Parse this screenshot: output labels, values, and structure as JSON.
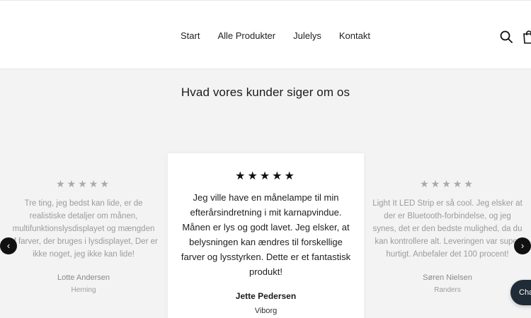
{
  "nav": {
    "items": [
      "Start",
      "Alle Produkter",
      "Julelys",
      "Kontakt"
    ]
  },
  "section": {
    "title": "Hvad vores kunder siger om os"
  },
  "reviews": [
    {
      "stars": "★★★★★",
      "text": "Tre ting, jeg bedst kan lide, er de realistiske detaljer om månen, multifunktionslysdisplayet og mængden af farver, der bruges i lysdisplayet, Der er ikke noget, jeg ikke kan lide!",
      "name": "Lotte Andersen",
      "city": "Herning"
    },
    {
      "stars": "★★★★★",
      "text": "Jeg ville have en månelampe til min efterårsindretning i mit karnapvindue. Månen er lys og godt lavet. Jeg elsker, at belysningen kan ændres til forskellige farver og lysstyrken. Dette er et fantastisk produkt!",
      "name": "Jette Pedersen",
      "city": "Viborg"
    },
    {
      "stars": "★★★★★",
      "text": "Light It LED Strip er så cool. Jeg elsker at der er Bluetooth-forbindelse, og jeg synes, det er den bedste mulighed, da du kan kontrollere alt. Leveringen var super hurtigt. Anbefaler det 100 procent!",
      "name": "Søren Nielsen",
      "city": "Randers"
    }
  ],
  "carousel": {
    "prev": "‹",
    "next": "›"
  },
  "chat": {
    "label": "Chat"
  }
}
